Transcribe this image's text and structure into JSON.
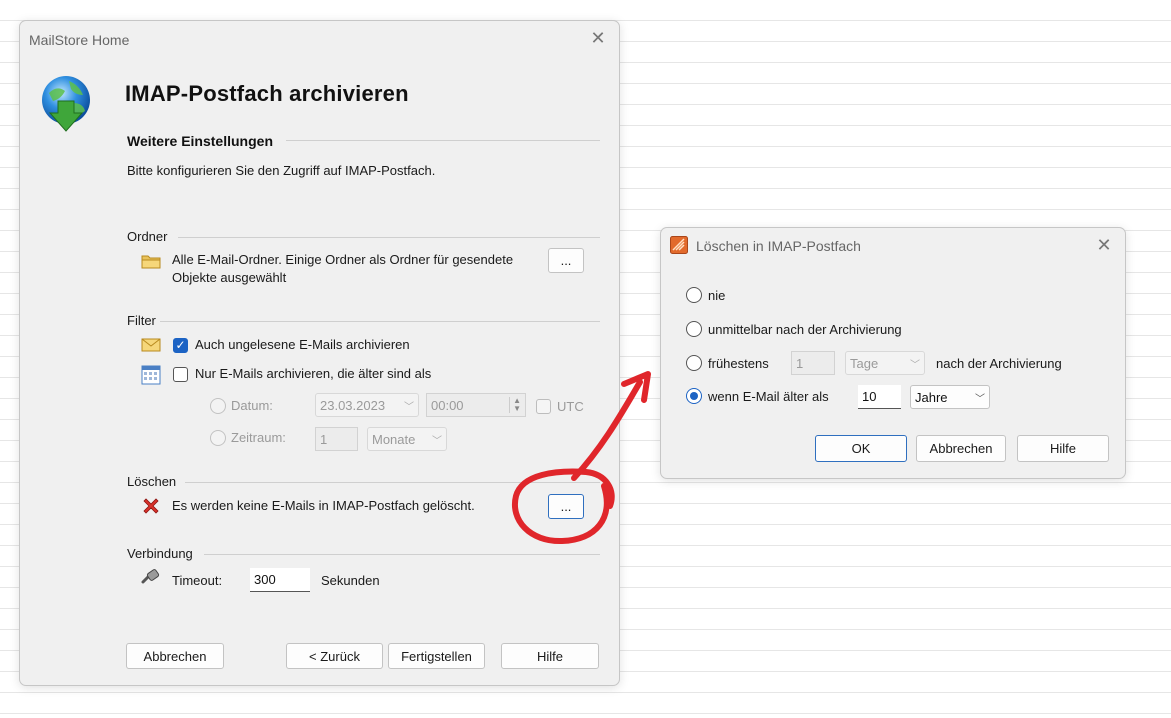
{
  "main_dialog": {
    "window_title": "MailStore Home",
    "heading": "IMAP-Postfach archivieren",
    "subheading": "Weitere Einstellungen",
    "description": "Bitte konfigurieren Sie den Zugriff auf IMAP-Postfach.",
    "folders": {
      "section_label": "Ordner",
      "text_line1": "Alle E-Mail-Ordner. Einige Ordner als Ordner für gesendete",
      "text_line2": "Objekte ausgewählt",
      "button_label": "..."
    },
    "filter": {
      "section_label": "Filter",
      "unread_label": "Auch ungelesene E-Mails archivieren",
      "unread_checked": true,
      "older_label": "Nur E-Mails archivieren, die älter sind als",
      "older_checked": false,
      "date_label": "Datum:",
      "date_value": "23.03.2023",
      "time_value": "00:00",
      "utc_label": "UTC",
      "period_label": "Zeitraum:",
      "period_value": "1",
      "period_unit": "Monate"
    },
    "delete": {
      "section_label": "Löschen",
      "status_text": "Es werden keine E-Mails in IMAP-Postfach gelöscht.",
      "button_label": "..."
    },
    "connection": {
      "section_label": "Verbindung",
      "timeout_label": "Timeout:",
      "timeout_value": "300",
      "unit_label": "Sekunden"
    },
    "footer": {
      "cancel": "Abbrechen",
      "back": "< Zurück",
      "finish": "Fertigstellen",
      "help": "Hilfe"
    }
  },
  "delete_dialog": {
    "title": "Löschen in IMAP-Postfach",
    "options": {
      "never": "nie",
      "immediately": "unmittelbar nach der Archivierung",
      "earliest": "frühestens",
      "earliest_value": "1",
      "earliest_unit": "Tage",
      "earliest_suffix": "nach der Archivierung",
      "older": "wenn E-Mail älter als",
      "older_value": "10",
      "older_unit": "Jahre"
    },
    "selected_option": "older",
    "buttons": {
      "ok": "OK",
      "cancel": "Abbrechen",
      "help": "Hilfe"
    }
  },
  "annotation": {
    "color": "#e0262b"
  }
}
